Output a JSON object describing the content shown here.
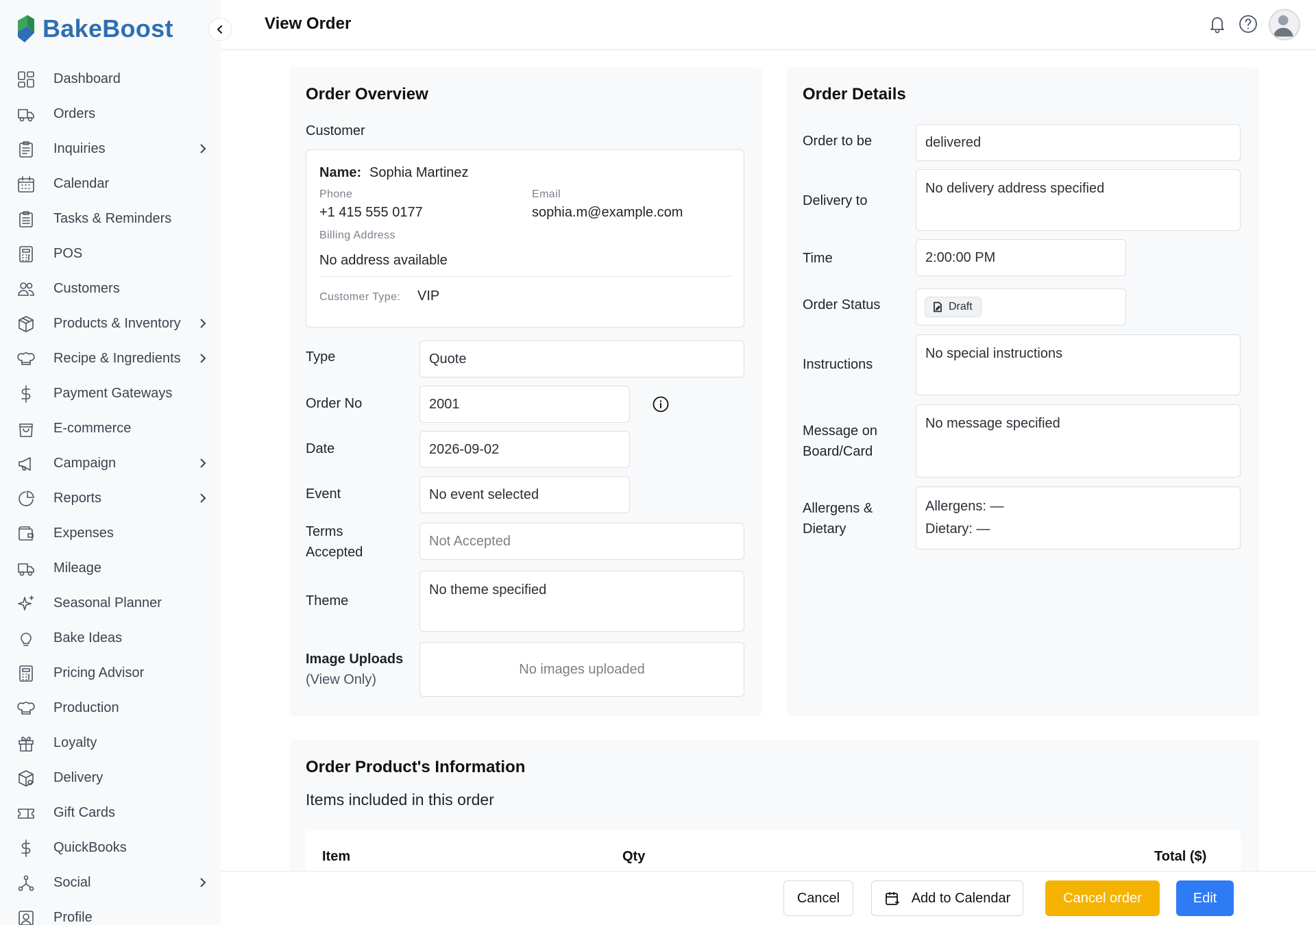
{
  "app": {
    "brand": "BakeBoost",
    "brand_color": "#2f6fb3"
  },
  "header": {
    "title": "View Order"
  },
  "sidebar": {
    "items": [
      {
        "label": "Dashboard",
        "icon": "dashboard-icon",
        "chevron": false
      },
      {
        "label": "Orders",
        "icon": "truck-icon",
        "chevron": false
      },
      {
        "label": "Inquiries",
        "icon": "clipboard-icon",
        "chevron": true
      },
      {
        "label": "Calendar",
        "icon": "calendar-icon",
        "chevron": false
      },
      {
        "label": "Tasks & Reminders",
        "icon": "clipboard-list-icon",
        "chevron": false
      },
      {
        "label": "POS",
        "icon": "calculator-icon",
        "chevron": false
      },
      {
        "label": "Customers",
        "icon": "users-icon",
        "chevron": false
      },
      {
        "label": "Products & Inventory",
        "icon": "box-icon",
        "chevron": true
      },
      {
        "label": "Recipe & Ingredients",
        "icon": "chef-hat-icon",
        "chevron": true
      },
      {
        "label": "Payment Gateways",
        "icon": "dollar-icon",
        "chevron": false
      },
      {
        "label": "E-commerce",
        "icon": "shopping-bag-icon",
        "chevron": false
      },
      {
        "label": "Campaign",
        "icon": "megaphone-icon",
        "chevron": true
      },
      {
        "label": "Reports",
        "icon": "pie-chart-icon",
        "chevron": true
      },
      {
        "label": "Expenses",
        "icon": "wallet-icon",
        "chevron": false
      },
      {
        "label": "Mileage",
        "icon": "truck-icon",
        "chevron": false
      },
      {
        "label": "Seasonal Planner",
        "icon": "sparkles-icon",
        "chevron": false
      },
      {
        "label": "Bake Ideas",
        "icon": "lightbulb-icon",
        "chevron": false
      },
      {
        "label": "Pricing Advisor",
        "icon": "calculator-icon",
        "chevron": false
      },
      {
        "label": "Production",
        "icon": "chef-hat-icon",
        "chevron": false
      },
      {
        "label": "Loyalty",
        "icon": "gift-icon",
        "chevron": false
      },
      {
        "label": "Delivery",
        "icon": "package-icon",
        "chevron": false
      },
      {
        "label": "Gift Cards",
        "icon": "ticket-icon",
        "chevron": false
      },
      {
        "label": "QuickBooks",
        "icon": "dollar-icon",
        "chevron": false
      },
      {
        "label": "Social",
        "icon": "share-nodes-icon",
        "chevron": true
      },
      {
        "label": "Profile",
        "icon": "user-square-icon",
        "chevron": false
      }
    ]
  },
  "overview": {
    "title": "Order Overview",
    "customer_heading": "Customer",
    "name_label": "Name:",
    "name": "Sophia Martinez",
    "phone_label": "Phone",
    "phone": "+1 415 555 0177",
    "email_label": "Email",
    "email": "sophia.m@example.com",
    "billing_label": "Billing Address",
    "billing": "No address available",
    "type_label": "Customer Type:",
    "type": "VIP",
    "fields": {
      "type_label": "Type",
      "type_value": "Quote",
      "order_no_label": "Order No",
      "order_no_value": "2001",
      "date_label": "Date",
      "date_value": "2026-09-02",
      "event_label": "Event",
      "event_value": "No event selected",
      "terms_label_1": "Terms",
      "terms_label_2": "Accepted",
      "terms_value": "Not Accepted",
      "theme_label": "Theme",
      "theme_value": "No theme specified",
      "images_label_1": "Image Uploads",
      "images_label_2": "(View Only)",
      "images_value": "No images uploaded"
    }
  },
  "details": {
    "title": "Order Details",
    "order_to_be_label": "Order to be",
    "order_to_be_value": "delivered",
    "delivery_label": "Delivery to",
    "delivery_value": "No delivery address specified",
    "time_label": "Time",
    "time_value": "2:00:00 PM",
    "status_label": "Order Status",
    "status_value": "Draft",
    "instructions_label": "Instructions",
    "instructions_value": "No special instructions",
    "message_label_1": "Message on",
    "message_label_2": "Board/Card",
    "message_value": "No message specified",
    "allergens_label_1": "Allergens &",
    "allergens_label_2": "Dietary",
    "allergens_value": "Allergens: —",
    "dietary_value": "Dietary: —"
  },
  "products": {
    "title": "Order Product's Information",
    "subtitle": "Items included in this order",
    "columns": [
      "Item",
      "Qty",
      "Total ($)"
    ]
  },
  "footer": {
    "cancel": "Cancel",
    "add_calendar": "Add to Calendar",
    "cancel_order": "Cancel order",
    "edit": "Edit",
    "colors": {
      "cancel_order": "#f5b301",
      "edit": "#2f7bf5"
    }
  }
}
